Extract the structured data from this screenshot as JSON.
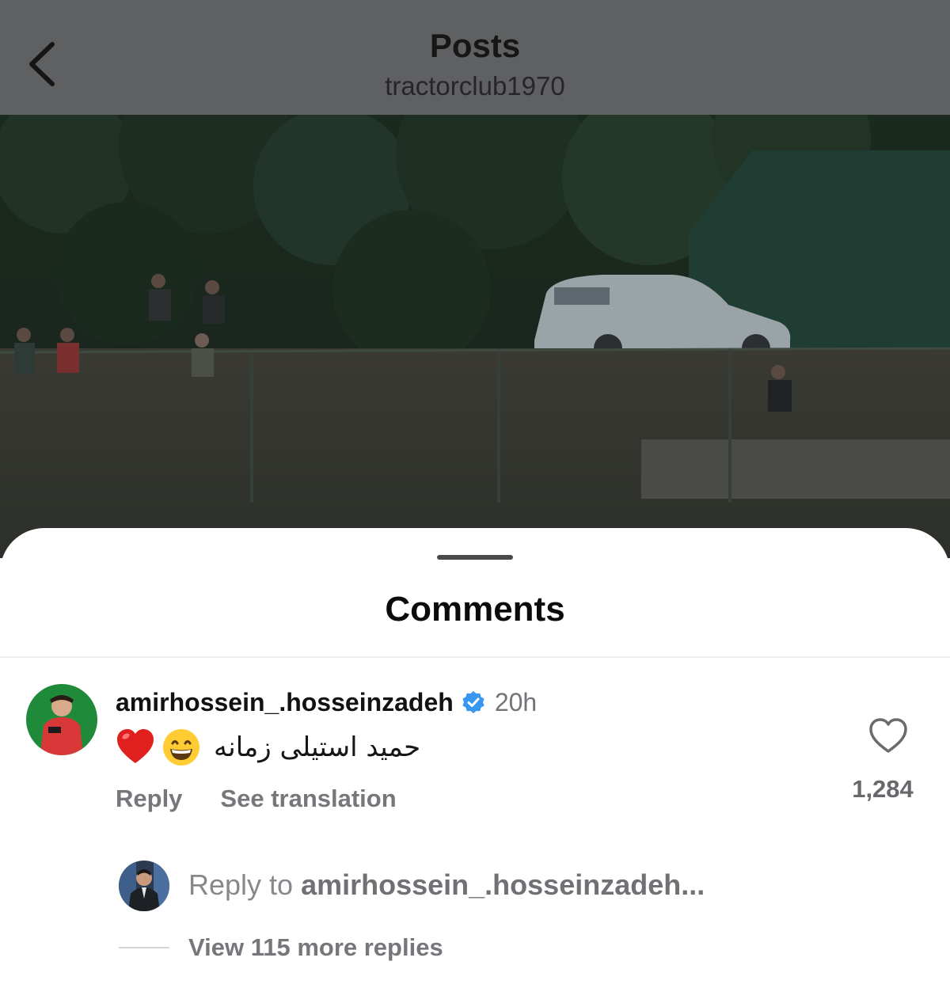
{
  "header": {
    "title": "Posts",
    "subtitle": "tractorclub1970",
    "back_icon": "chevron-left-icon"
  },
  "post_image": {
    "description_icon": "photo-image"
  },
  "comments_sheet": {
    "title": "Comments",
    "comment": {
      "username": "amirhossein_.hosseinzadeh",
      "verified": true,
      "timestamp": "20h",
      "text": "حمید استیلی زمانه",
      "emojis": [
        "red-heart-emoji",
        "grinning-face-emoji"
      ],
      "reply_label": "Reply",
      "translate_label": "See translation",
      "like_count": "1,284"
    },
    "reply_box": {
      "prefix": "Reply to",
      "to_user": "amirhossein_.hosseinzadeh..."
    },
    "view_replies_label": "View 115 more replies"
  },
  "colors": {
    "header_bg": "#5f6062",
    "sheet_bg": "#ffffff",
    "verified_blue": "#3897f0",
    "muted_text": "#76777b"
  }
}
